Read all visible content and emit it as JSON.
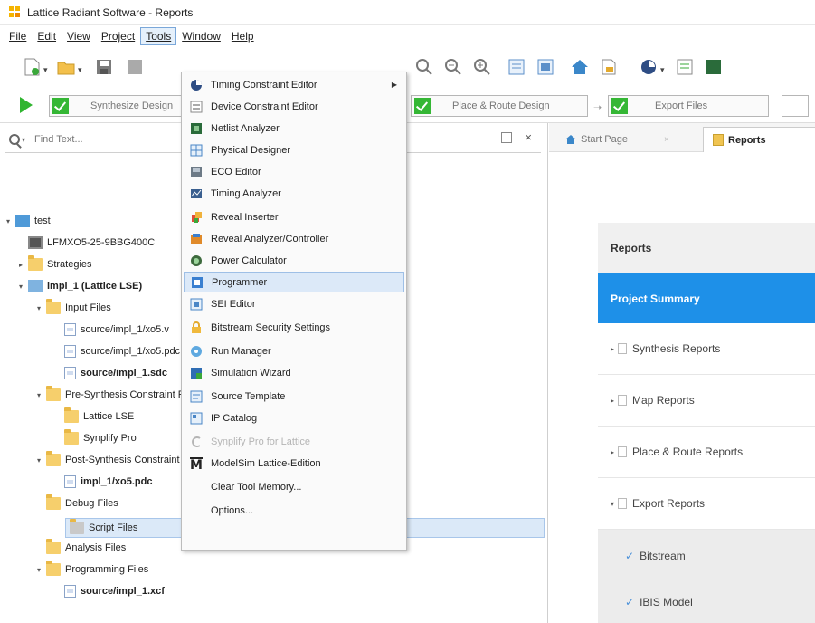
{
  "window": {
    "title": "Lattice Radiant Software - Reports"
  },
  "menubar": {
    "items": [
      {
        "label": "File",
        "name": "menu-file"
      },
      {
        "label": "Edit",
        "name": "menu-edit"
      },
      {
        "label": "View",
        "name": "menu-view"
      },
      {
        "label": "Project",
        "name": "menu-project"
      },
      {
        "label": "Tools",
        "name": "menu-tools"
      },
      {
        "label": "Window",
        "name": "menu-window"
      },
      {
        "label": "Help",
        "name": "menu-help"
      }
    ]
  },
  "flow": {
    "steps": [
      {
        "label": "Synthesize Design"
      },
      {
        "label": "Place & Route Design"
      },
      {
        "label": "Export Files"
      }
    ]
  },
  "find": {
    "placeholder": "Find Text..."
  },
  "tree": {
    "rows": [
      {
        "label": "test"
      },
      {
        "label": "LFMXO5-25-9BBG400C"
      },
      {
        "label": "Strategies"
      },
      {
        "label": "impl_1 (Lattice LSE)"
      },
      {
        "label": "Input Files"
      },
      {
        "label": "source/impl_1/xo5.v"
      },
      {
        "label": "source/impl_1/xo5.pdc"
      },
      {
        "label": "source/impl_1.sdc"
      },
      {
        "label": "Pre-Synthesis Constraint Files"
      },
      {
        "label": "Lattice LSE"
      },
      {
        "label": "Synplify Pro"
      },
      {
        "label": "Post-Synthesis Constraint Files"
      },
      {
        "label": "impl_1/xo5.pdc"
      },
      {
        "label": "Debug Files"
      },
      {
        "label": "Script Files"
      },
      {
        "label": "Analysis Files"
      },
      {
        "label": "Programming Files"
      },
      {
        "label": "source/impl_1.xcf"
      }
    ]
  },
  "tabs": [
    {
      "label": "Start Page"
    },
    {
      "label": "Reports"
    }
  ],
  "reports": {
    "header": "Reports",
    "summary": "Project Summary",
    "items": [
      {
        "label": "Synthesis Reports"
      },
      {
        "label": "Map Reports"
      },
      {
        "label": "Place & Route Reports"
      },
      {
        "label": "Export Reports"
      }
    ],
    "subitems": [
      {
        "label": "Bitstream"
      },
      {
        "label": "IBIS Model"
      }
    ]
  },
  "toolsmenu": {
    "items": [
      {
        "label": "Timing Constraint Editor",
        "icon": "timing-constraint-editor-icon"
      },
      {
        "label": "Device Constraint Editor",
        "icon": "device-constraint-editor-icon"
      },
      {
        "label": "Netlist Analyzer",
        "icon": "netlist-analyzer-icon"
      },
      {
        "label": "Physical Designer",
        "icon": "physical-designer-icon"
      },
      {
        "label": "ECO Editor",
        "icon": "eco-editor-icon"
      },
      {
        "label": "Timing Analyzer",
        "icon": "timing-analyzer-icon"
      },
      {
        "label": "Reveal Inserter",
        "icon": "reveal-inserter-icon"
      },
      {
        "label": "Reveal Analyzer/Controller",
        "icon": "reveal-analyzer-icon"
      },
      {
        "label": "Power Calculator",
        "icon": "power-calculator-icon"
      },
      {
        "label": "Programmer",
        "icon": "programmer-icon"
      },
      {
        "label": "SEI Editor",
        "icon": "sei-editor-icon"
      },
      {
        "label": "Bitstream Security Settings",
        "icon": "lock-icon"
      },
      {
        "label": "Run Manager",
        "icon": "run-manager-icon"
      },
      {
        "label": "Simulation Wizard",
        "icon": "simulation-wizard-icon"
      },
      {
        "label": "Source Template",
        "icon": "source-template-icon"
      },
      {
        "label": "IP Catalog",
        "icon": "ip-catalog-icon"
      },
      {
        "label": "Synplify Pro for Lattice",
        "icon": "synplify-icon"
      },
      {
        "label": "ModelSim Lattice-Edition",
        "icon": "modelsim-icon"
      },
      {
        "label": "Clear Tool Memory...",
        "icon": ""
      },
      {
        "label": "Options...",
        "icon": ""
      }
    ]
  },
  "colors": {
    "accent": "#1e90e8",
    "menu_highlight": "#dce9f8",
    "flow_check": "#35b735",
    "folder": "#f6cf6c"
  }
}
